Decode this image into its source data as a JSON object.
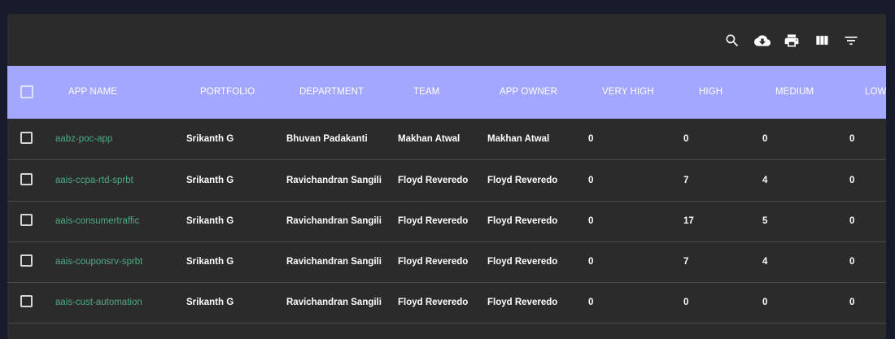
{
  "toolbar": {
    "icons": [
      "search-icon",
      "cloud-download-icon",
      "print-icon",
      "view-column-icon",
      "filter-list-icon"
    ]
  },
  "table": {
    "columns": [
      "APP NAME",
      "PORTFOLIO",
      "DEPARTMENT",
      "TEAM",
      "APP OWNER",
      "VERY HIGH",
      "HIGH",
      "MEDIUM",
      "LOW"
    ],
    "rows": [
      [
        "aabz-poc-app",
        "Srikanth G",
        "Bhuvan Padakanti",
        "Makhan Atwal",
        "Makhan Atwal",
        "0",
        "0",
        "0",
        "0"
      ],
      [
        "aais-ccpa-rtd-sprbt",
        "Srikanth G",
        "Ravichandran Sangili",
        "Floyd Reveredo",
        "Floyd Reveredo",
        "0",
        "7",
        "4",
        "0"
      ],
      [
        "aais-consumertraffic",
        "Srikanth G",
        "Ravichandran Sangili",
        "Floyd Reveredo",
        "Floyd Reveredo",
        "0",
        "17",
        "5",
        "0"
      ],
      [
        "aais-couponsrv-sprbt",
        "Srikanth G",
        "Ravichandran Sangili",
        "Floyd Reveredo",
        "Floyd Reveredo",
        "0",
        "7",
        "4",
        "0"
      ],
      [
        "aais-cust-automation",
        "Srikanth G",
        "Ravichandran Sangili",
        "Floyd Reveredo",
        "Floyd Reveredo",
        "0",
        "0",
        "0",
        "0"
      ]
    ]
  },
  "colors": {
    "header_bg": "#a4a7ff",
    "panel_bg": "#2b2b2b",
    "page_bg": "#161a2b",
    "link": "#4dab82"
  }
}
